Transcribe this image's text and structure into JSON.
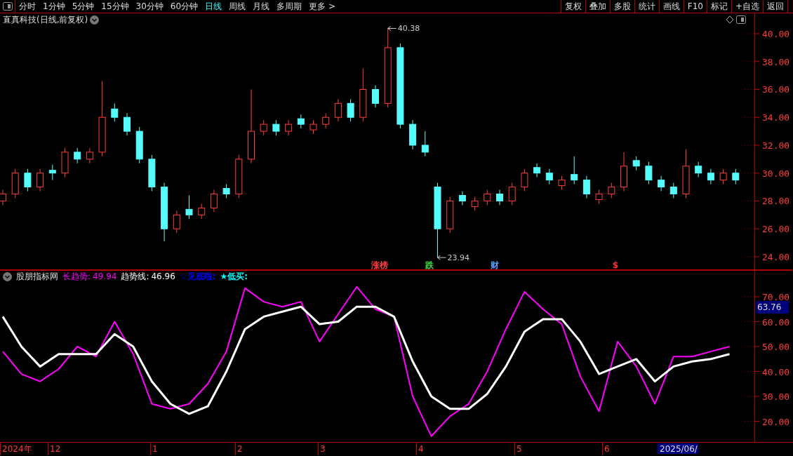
{
  "toolbar": {
    "periods": [
      {
        "label": "分时",
        "selected": false
      },
      {
        "label": "1分钟",
        "selected": false
      },
      {
        "label": "5分钟",
        "selected": false
      },
      {
        "label": "15分钟",
        "selected": false
      },
      {
        "label": "30分钟",
        "selected": false
      },
      {
        "label": "60分钟",
        "selected": false
      },
      {
        "label": "日线",
        "selected": true
      },
      {
        "label": "周线",
        "selected": false
      },
      {
        "label": "月线",
        "selected": false
      },
      {
        "label": "多周期",
        "selected": false
      },
      {
        "label": "更多 >",
        "selected": false
      }
    ],
    "actions": [
      "复权",
      "叠加",
      "多股",
      "统计",
      "画线",
      "F10",
      "标记",
      "+自选",
      "返回"
    ]
  },
  "price_panel": {
    "title": "直真科技(日线,前复权)",
    "chart_data": {
      "type": "candlestick",
      "ylim": [
        23.04,
        41.46
      ],
      "yticks": [
        {
          "value": 40,
          "label": "40.00"
        },
        {
          "value": 38,
          "label": "38.00"
        },
        {
          "value": 36,
          "label": "36.00"
        },
        {
          "value": 34,
          "label": "34.00"
        },
        {
          "value": 32,
          "label": "32.00"
        },
        {
          "value": 30,
          "label": "30.00"
        },
        {
          "value": 28,
          "label": "28.00"
        },
        {
          "value": 26,
          "label": "26.00"
        },
        {
          "value": 24,
          "label": "24.00"
        }
      ],
      "ohlc": [
        [
          28,
          28.8,
          27.7,
          28.5
        ],
        [
          28.5,
          30.3,
          28.2,
          30
        ],
        [
          30,
          30.3,
          28.7,
          29
        ],
        [
          29,
          30.3,
          28.7,
          30
        ],
        [
          30.2,
          30.6,
          29.5,
          30
        ],
        [
          30,
          31.8,
          29.7,
          31.5
        ],
        [
          31.5,
          31.8,
          30.7,
          31
        ],
        [
          31,
          31.8,
          30.7,
          31.5
        ],
        [
          31.5,
          36.6,
          31.2,
          34
        ],
        [
          34.6,
          35,
          33.7,
          34
        ],
        [
          34,
          34.3,
          32.7,
          33
        ],
        [
          33,
          33.3,
          30.7,
          31
        ],
        [
          31,
          31.3,
          28.7,
          29
        ],
        [
          29,
          29.3,
          25.1,
          26
        ],
        [
          26,
          27.3,
          25.7,
          27
        ],
        [
          27.4,
          28.4,
          26.7,
          27
        ],
        [
          27,
          27.8,
          26.7,
          27.5
        ],
        [
          27.5,
          28.8,
          27.2,
          28.5
        ],
        [
          28.9,
          29.2,
          28.2,
          28.5
        ],
        [
          28.5,
          31.3,
          28.2,
          31
        ],
        [
          31,
          36,
          30.7,
          33
        ],
        [
          33,
          33.8,
          32.7,
          33.5
        ],
        [
          33.5,
          33.8,
          32.7,
          33
        ],
        [
          33,
          33.8,
          32.7,
          33.5
        ],
        [
          33.9,
          34.2,
          33.2,
          33.5
        ],
        [
          33.1,
          33.8,
          32.8,
          33.5
        ],
        [
          33.5,
          34.3,
          33.2,
          34
        ],
        [
          34,
          35.3,
          33.7,
          35
        ],
        [
          35,
          35.3,
          33.7,
          34
        ],
        [
          34,
          37.5,
          33.7,
          36
        ],
        [
          36,
          36.3,
          34.7,
          35
        ],
        [
          35,
          40.38,
          34.7,
          39
        ],
        [
          39,
          39.3,
          33.2,
          33.5
        ],
        [
          33.5,
          33.8,
          31.7,
          32
        ],
        [
          32,
          33,
          31.2,
          31.5
        ],
        [
          29,
          29.3,
          23.94,
          26
        ],
        [
          26,
          28.3,
          25.7,
          28
        ],
        [
          28.4,
          28.7,
          27.7,
          28
        ],
        [
          27.6,
          28.3,
          27.3,
          28
        ],
        [
          28,
          28.8,
          27.7,
          28.5
        ],
        [
          28.5,
          28.8,
          27.7,
          28
        ],
        [
          28,
          29.3,
          27.7,
          29
        ],
        [
          29,
          30.3,
          28.7,
          30
        ],
        [
          30.4,
          30.7,
          29.7,
          30
        ],
        [
          30,
          30.3,
          29.2,
          29.5
        ],
        [
          29.1,
          29.8,
          28.8,
          29.5
        ],
        [
          29.9,
          31.2,
          29.2,
          29.5
        ],
        [
          29.5,
          29.8,
          28.2,
          28.5
        ],
        [
          28.1,
          28.8,
          27.8,
          28.5
        ],
        [
          28.5,
          29.3,
          28.2,
          29
        ],
        [
          29,
          31.5,
          28.7,
          30.5
        ],
        [
          30.9,
          31.2,
          30.2,
          30.5
        ],
        [
          30.5,
          30.8,
          29.2,
          29.5
        ],
        [
          29.5,
          29.8,
          28.7,
          29
        ],
        [
          29,
          29.3,
          28.2,
          28.5
        ],
        [
          28.5,
          31.7,
          28.2,
          30.5
        ],
        [
          30.5,
          30.8,
          29.7,
          30
        ],
        [
          30,
          30.3,
          29.2,
          29.5
        ],
        [
          29.5,
          30.3,
          29.2,
          30
        ],
        [
          30,
          30.3,
          29.2,
          29.5
        ]
      ],
      "annotations": [
        "40.38",
        "23.94"
      ]
    },
    "event_markers": [
      {
        "label": "涨榜",
        "color": "#ff4040"
      },
      {
        "label": "跌",
        "color": "#40e040"
      },
      {
        "label": "财",
        "color": "#60a0ff"
      },
      {
        "label": "$",
        "color": "#ff3030"
      }
    ]
  },
  "indicator_panel": {
    "title": "股朋指标网",
    "legend_values": [
      "49.94",
      "46.96"
    ],
    "signals": [
      {
        "label": "☆见底啦:",
        "color": "#0000ff"
      },
      {
        "label": "★低买:",
        "color": "#00ffff"
      }
    ],
    "cursor_value": "63.76",
    "date_axis": [
      {
        "label": "2024年",
        "selected": false
      },
      {
        "label": "12",
        "selected": false
      },
      {
        "label": "1",
        "selected": false
      },
      {
        "label": "2",
        "selected": false
      },
      {
        "label": "3",
        "selected": false
      },
      {
        "label": "4",
        "selected": false
      },
      {
        "label": "5",
        "selected": false
      },
      {
        "label": "6",
        "selected": false
      },
      {
        "label": "2025/06/",
        "selected": true
      }
    ],
    "chart_data": {
      "type": "line",
      "ylim": [
        11.7,
        80.7
      ],
      "yticks": [
        {
          "value": 70,
          "label": "70.00"
        },
        {
          "value": 60,
          "label": "60.00"
        },
        {
          "value": 50,
          "label": "50.00"
        },
        {
          "value": 40,
          "label": "40.00"
        },
        {
          "value": 30,
          "label": "30.00"
        },
        {
          "value": 20,
          "label": "20.00"
        }
      ],
      "series": [
        {
          "name": "长趋势:",
          "color": "#ff00ff",
          "values": [
            48,
            39,
            36,
            41,
            50,
            46,
            60,
            47,
            27,
            25,
            27,
            35,
            48,
            73.5,
            68,
            66,
            68,
            52,
            63,
            74,
            65,
            62,
            30,
            14,
            22,
            27,
            40,
            57,
            72,
            65,
            59,
            38,
            24,
            52,
            42,
            27,
            46,
            46,
            48,
            50
          ]
        },
        {
          "name": "趋势线:",
          "color": "#ffffff",
          "values": [
            62,
            50,
            42,
            47,
            47,
            47,
            55,
            50,
            36,
            27,
            23,
            26,
            40,
            57,
            62,
            64,
            66,
            59,
            60,
            66,
            66,
            62,
            44,
            30,
            25,
            25,
            31,
            42,
            56,
            61,
            61,
            52,
            39,
            42,
            45,
            36,
            42,
            44,
            45,
            47
          ]
        }
      ]
    }
  }
}
